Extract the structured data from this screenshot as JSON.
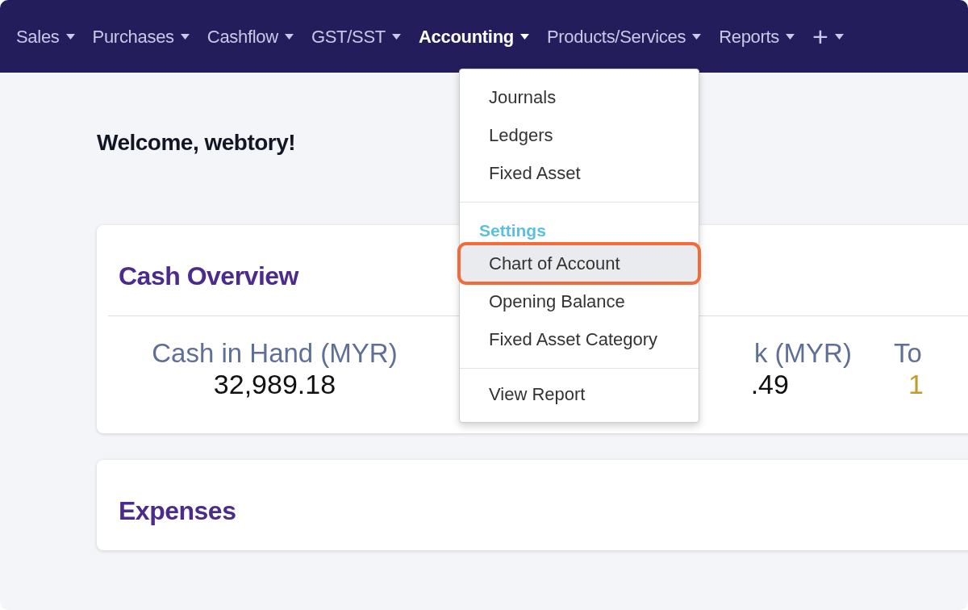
{
  "navbar": {
    "items": [
      {
        "label": "Sales",
        "selected": false
      },
      {
        "label": "Purchases",
        "selected": false
      },
      {
        "label": "Cashflow",
        "selected": false
      },
      {
        "label": "GST/SST",
        "selected": false
      },
      {
        "label": "Accounting",
        "selected": true
      },
      {
        "label": "Products/Services",
        "selected": false
      },
      {
        "label": "Reports",
        "selected": false
      },
      {
        "label": "+",
        "selected": false
      }
    ]
  },
  "welcome": "Welcome, webtory!",
  "cash_overview": {
    "title": "Cash Overview",
    "stats": [
      {
        "label": "Cash in Hand (MYR)",
        "value": "32,989.18"
      },
      {
        "label": "k (MYR)",
        "value": ".49"
      },
      {
        "label": "To",
        "value": "1"
      }
    ]
  },
  "expenses": {
    "title": "Expenses"
  },
  "dropdown": {
    "items": [
      {
        "kind": "item",
        "label": "Journals",
        "selected": false
      },
      {
        "kind": "item",
        "label": "Ledgers",
        "selected": false
      },
      {
        "kind": "item",
        "label": "Fixed Asset",
        "selected": false
      },
      {
        "kind": "divider"
      },
      {
        "kind": "header",
        "label": "Settings"
      },
      {
        "kind": "item",
        "label": "Chart of Account",
        "selected": true
      },
      {
        "kind": "item",
        "label": "Opening Balance",
        "selected": false
      },
      {
        "kind": "item",
        "label": "Fixed Asset Category",
        "selected": false
      },
      {
        "kind": "divider"
      },
      {
        "kind": "item",
        "label": "View Report",
        "selected": false
      }
    ]
  }
}
